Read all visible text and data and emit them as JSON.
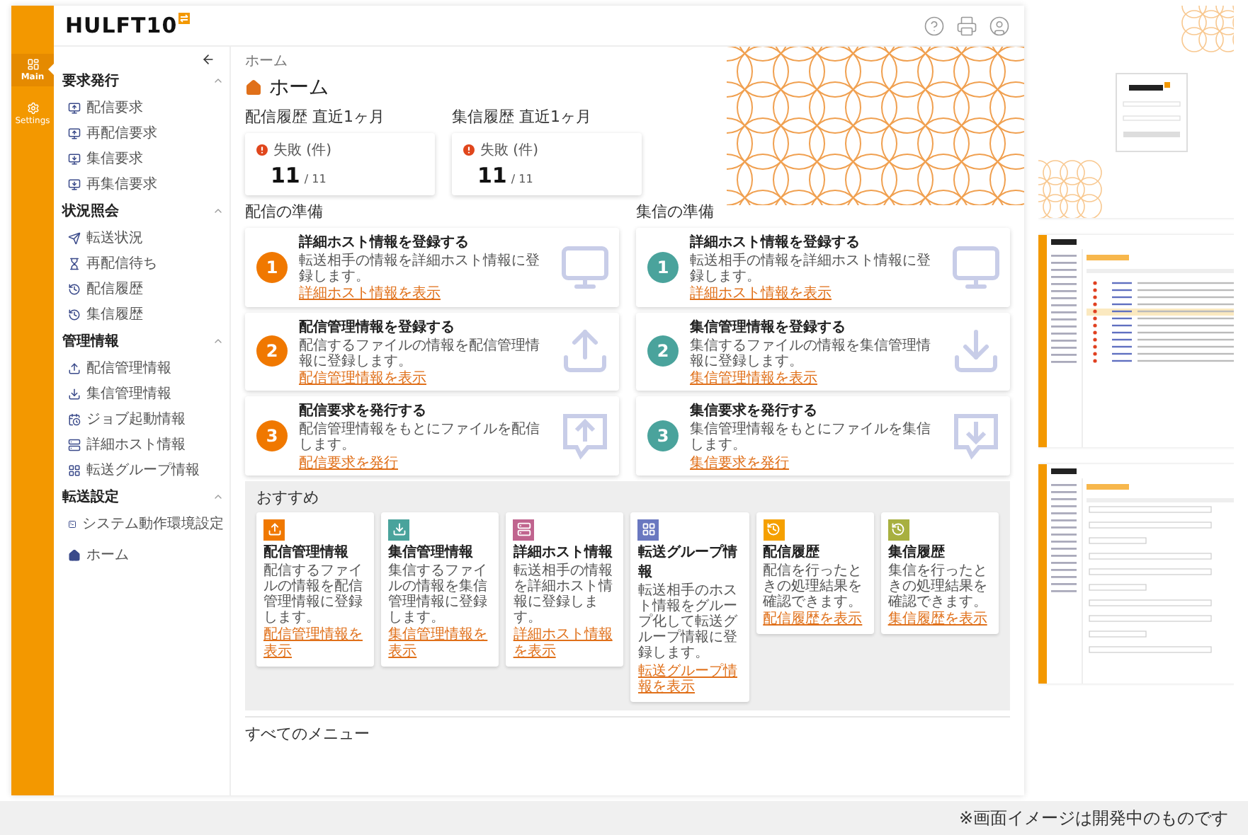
{
  "app": {
    "logo": "HULFT10",
    "rail": [
      {
        "label": "Main",
        "selected": true
      },
      {
        "label": "Settings",
        "selected": false
      }
    ]
  },
  "sidebar": {
    "groups": [
      {
        "title": "要求発行",
        "expanded": true,
        "items": [
          "配信要求",
          "再配信要求",
          "集信要求",
          "再集信要求"
        ]
      },
      {
        "title": "状況照会",
        "expanded": true,
        "items": [
          "転送状況",
          "再配信待ち",
          "配信履歴",
          "集信履歴"
        ]
      },
      {
        "title": "管理情報",
        "expanded": true,
        "items": [
          "配信管理情報",
          "集信管理情報",
          "ジョブ起動情報",
          "詳細ホスト情報",
          "転送グループ情報"
        ]
      },
      {
        "title": "転送設定",
        "expanded": true,
        "items": [
          "システム動作環境設定"
        ]
      }
    ],
    "home": "ホーム"
  },
  "content": {
    "breadcrumb": "ホーム",
    "title": "ホーム",
    "history": [
      {
        "title": "配信履歴 直近1ヶ月",
        "label": "失敗 (件)",
        "count": "11",
        "total": "/ 11"
      },
      {
        "title": "集信履歴 直近1ヶ月",
        "label": "失敗 (件)",
        "count": "11",
        "total": "/ 11"
      }
    ],
    "preparation": [
      {
        "title": "配信の準備",
        "kind": "send",
        "color": "#f07800",
        "steps": [
          {
            "number": "1",
            "title": "詳細ホスト情報を登録する",
            "description": "転送相手の情報を詳細ホスト情報に登録します。",
            "link": "詳細ホスト情報を表示"
          },
          {
            "number": "2",
            "title": "配信管理情報を登録する",
            "description": "配信するファイルの情報を配信管理情報に登録します。",
            "link": "配信管理情報を表示"
          },
          {
            "number": "3",
            "title": "配信要求を発行する",
            "description": "配信管理情報をもとにファイルを配信します。",
            "link": "配信要求を発行"
          }
        ]
      },
      {
        "title": "集信の準備",
        "kind": "receive",
        "color": "#4aa39c",
        "steps": [
          {
            "number": "1",
            "title": "詳細ホスト情報を登録する",
            "description": "転送相手の情報を詳細ホスト情報に登録します。",
            "link": "詳細ホスト情報を表示"
          },
          {
            "number": "2",
            "title": "集信管理情報を登録する",
            "description": "集信するファイルの情報を集信管理情報に登録します。",
            "link": "集信管理情報を表示"
          },
          {
            "number": "3",
            "title": "集信要求を発行する",
            "description": "集信管理情報をもとにファイルを集信します。",
            "link": "集信要求を発行"
          }
        ]
      }
    ],
    "recommend": {
      "title": "おすすめ",
      "cards": [
        {
          "title": "配信管理情報",
          "description": "配信するファイルの情報を配信管理情報に登録します。",
          "link": "配信管理情報を表示",
          "color": "#f07800"
        },
        {
          "title": "集信管理情報",
          "description": "集信するファイルの情報を集信管理情報に登録します。",
          "link": "集信管理情報を表示",
          "color": "#4aa39c"
        },
        {
          "title": "詳細ホスト情報",
          "description": "転送相手の情報を詳細ホスト情報に登録します。",
          "link": "詳細ホスト情報を表示",
          "color": "#c0648e"
        },
        {
          "title": "転送グループ情報",
          "description": "転送相手のホスト情報をグループ化して転送グループ情報に登録します。",
          "link": "転送グループ情報を表示",
          "color": "#6a78c0"
        },
        {
          "title": "配信履歴",
          "description": "配信を行ったときの処理結果を確認できます。",
          "link": "配信履歴を表示",
          "color": "#f5a000"
        },
        {
          "title": "集信履歴",
          "description": "集信を行ったときの処理結果を確認できます。",
          "link": "集信履歴を表示",
          "color": "#a8b040"
        }
      ]
    },
    "all_menu_title": "すべてのメニュー"
  },
  "previews": [
    {
      "kind": "login"
    },
    {
      "kind": "table"
    },
    {
      "kind": "form"
    }
  ],
  "caption": "※画面イメージは開発中のものです"
}
